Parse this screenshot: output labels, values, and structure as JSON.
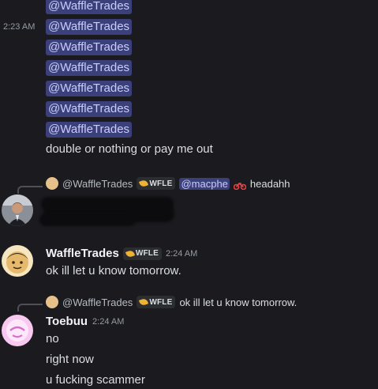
{
  "top_group": {
    "mentions": [
      "@WaffleTrades",
      "@WaffleTrades",
      "@WaffleTrades",
      "@WaffleTrades",
      "@WaffleTrades",
      "@WaffleTrades",
      "@WaffleTrades"
    ],
    "timestamp": "2:23 AM",
    "text": "double or nothing or pay me out"
  },
  "message_1": {
    "reply_name": "@WaffleTrades",
    "reply_tag": "WFLE",
    "reply_mention": "@macphe",
    "reply_text": "headahh"
  },
  "message_2": {
    "username": "WaffleTrades",
    "tag": "WFLE",
    "timestamp": "2:24 AM",
    "text": "ok ill let u know tomorrow."
  },
  "message_3": {
    "reply_name": "@WaffleTrades",
    "reply_tag": "WFLE",
    "reply_text": "ok ill let u know tomorrow.",
    "username": "Toebuu",
    "timestamp": "2:24 AM",
    "lines": [
      "no",
      "right now",
      "u fucking scammer"
    ]
  },
  "colors": {
    "background": "#1b1b1f",
    "mention_bg": "#3b3f7a",
    "mention_fg": "#c9cdfb",
    "tag_leaf": "#f0b232"
  }
}
